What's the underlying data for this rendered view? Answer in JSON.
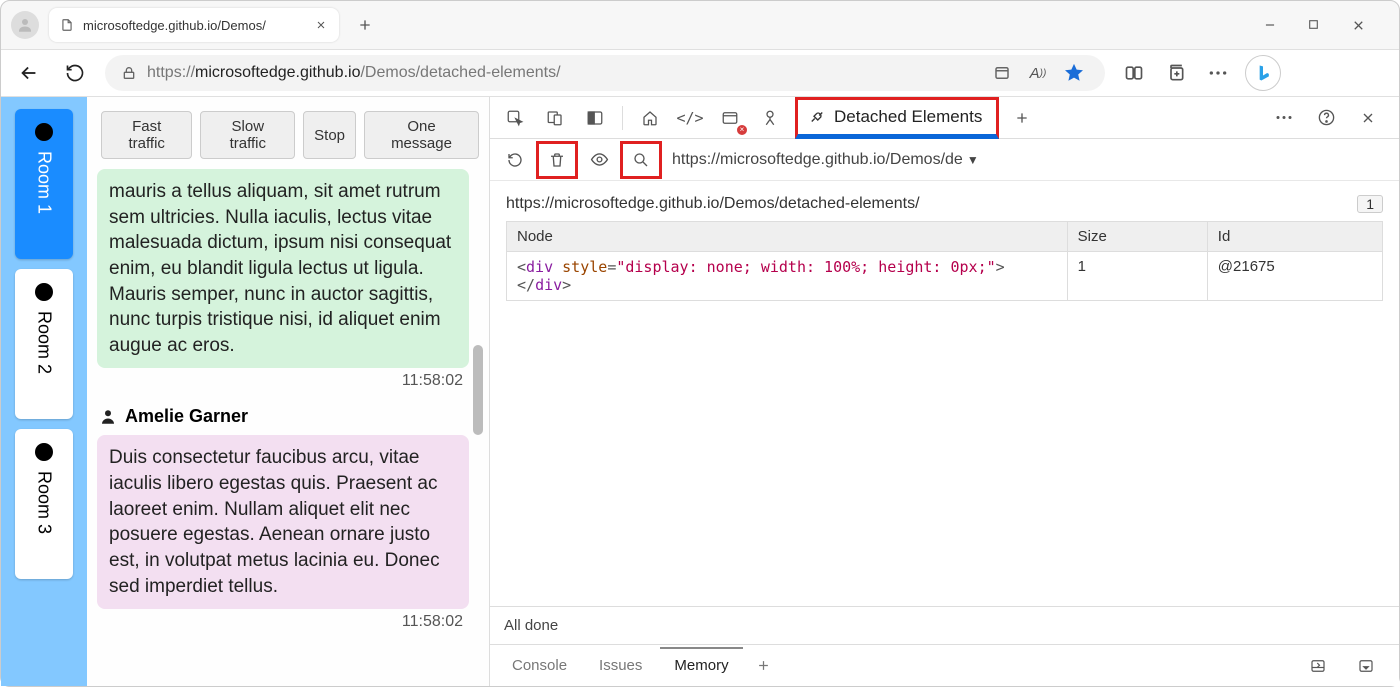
{
  "browser": {
    "tab_title": "microsoftedge.github.io/Demos/",
    "url_prefix": "https://",
    "url_host": "microsoftedge.github.io",
    "url_path": "/Demos/detached-elements/"
  },
  "app": {
    "rooms": [
      {
        "label": "Room 1",
        "active": true
      },
      {
        "label": "Room 2",
        "active": false
      },
      {
        "label": "Room 3",
        "active": false
      }
    ],
    "buttons": {
      "fast": "Fast traffic",
      "slow": "Slow traffic",
      "stop": "Stop",
      "one": "One message"
    },
    "messages": [
      {
        "author": null,
        "color": "green",
        "text": "mauris a tellus aliquam, sit amet rutrum sem ultricies. Nulla iaculis, lectus vitae malesuada dictum, ipsum nisi consequat enim, eu blandit ligula lectus ut ligula. Mauris semper, nunc in auctor sagittis, nunc turpis tristique nisi, id aliquet enim augue ac eros.",
        "ts": "11:58:02"
      },
      {
        "author": "Amelie Garner",
        "color": "pink",
        "text": "Duis consectetur faucibus arcu, vitae iaculis libero egestas quis. Praesent ac laoreet enim. Nullam aliquet elit nec posuere egestas. Aenean ornare justo est, in volutpat metus lacinia eu. Donec sed imperdiet tellus.",
        "ts": "11:58:02"
      }
    ]
  },
  "devtools": {
    "active_tool": "Detached Elements",
    "frame_url_short": "https://microsoftedge.github.io/Demos/de",
    "page_path": "https://microsoftedge.github.io/Demos/detached-elements/",
    "count": "1",
    "table": {
      "headers": {
        "node": "Node",
        "size": "Size",
        "id": "Id"
      },
      "rows": [
        {
          "node_html": "<div style=\"display: none; width: 100%; height: 0px;\"></div>",
          "size": "1",
          "id": "@21675"
        }
      ]
    },
    "status": "All done",
    "drawer": {
      "console": "Console",
      "issues": "Issues",
      "memory": "Memory"
    }
  }
}
